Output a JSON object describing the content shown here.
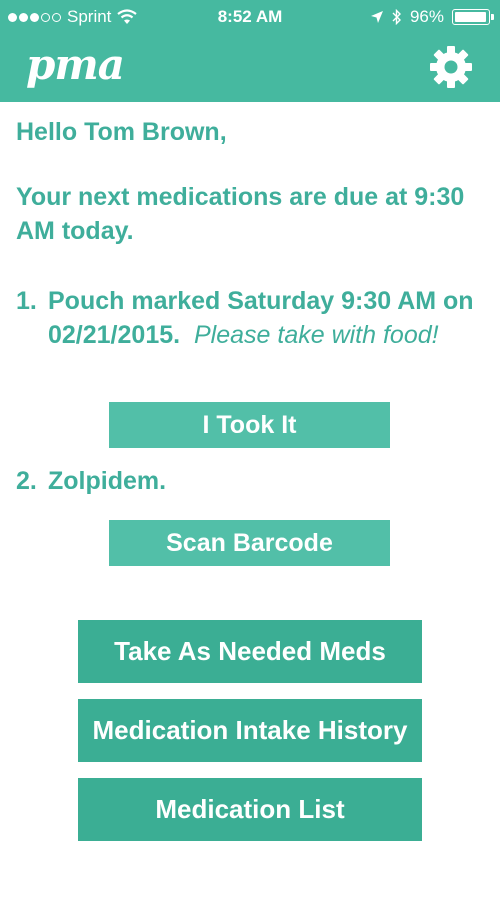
{
  "status_bar": {
    "carrier": "Sprint",
    "time": "8:52 AM",
    "battery": "96%",
    "battery_level": 0.96,
    "signal_bars_filled": 3,
    "signal_bars_total": 5,
    "icons": [
      "wifi-icon",
      "location-arrow-icon",
      "bluetooth-icon",
      "battery-icon"
    ]
  },
  "header": {
    "logo": "pma",
    "settings_icon": "gear-icon",
    "color": "#46b9a0"
  },
  "main": {
    "greeting": "Hello Tom Brown,",
    "due_message": "Your next medications are due at 9:30 AM today.",
    "medications": [
      {
        "number": "1.",
        "name": "Pouch marked Saturday 9:30 AM on 02/21/2015.",
        "note": "Please take with food!",
        "action_label": "I Took It"
      },
      {
        "number": "2.",
        "name": "Zolpidem.",
        "note": "",
        "action_label": "Scan Barcode"
      }
    ]
  },
  "actions": {
    "as_needed": "Take As Needed Meds",
    "history": "Medication Intake History",
    "list": "Medication List"
  },
  "colors": {
    "accent": "#46b9a0",
    "text": "#3fae9b",
    "button_light": "#52bfa8",
    "button_dark": "#3bae94"
  }
}
